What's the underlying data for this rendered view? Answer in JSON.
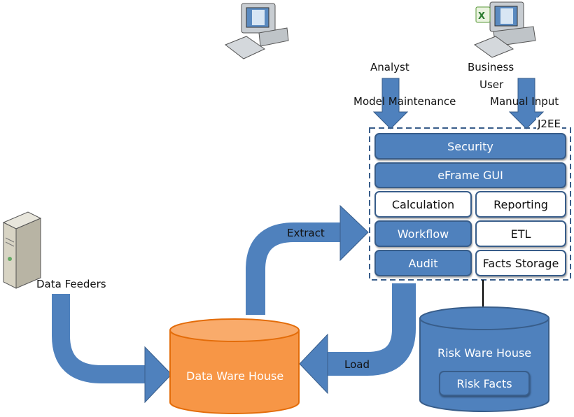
{
  "colors": {
    "blue": "#4f81bd",
    "blue_border": "#385d8a",
    "orange": "#f79646"
  },
  "actors": {
    "analyst": {
      "label": "Analyst",
      "icon": "computer-icon",
      "flow": "Model Maintenance"
    },
    "business_user": {
      "label_line1": "Business",
      "label_line2": "User",
      "icon": "computer-with-excel-icon",
      "flow": "Manual Input"
    }
  },
  "platform": {
    "label": "J2EE",
    "modules": {
      "security": "Security",
      "gui": "eFrame GUI",
      "calculation": "Calculation",
      "reporting": "Reporting",
      "workflow": "Workflow",
      "etl": "ETL",
      "audit": "Audit",
      "facts_storage": "Facts Storage"
    }
  },
  "data_feeders": {
    "label": "Data Feeders",
    "icon": "server-icon"
  },
  "data_warehouse": {
    "label": "Data Ware House"
  },
  "risk_warehouse": {
    "label": "Risk Ware House",
    "inner": "Risk Facts"
  },
  "flows": {
    "extract": "Extract",
    "load": "Load"
  }
}
